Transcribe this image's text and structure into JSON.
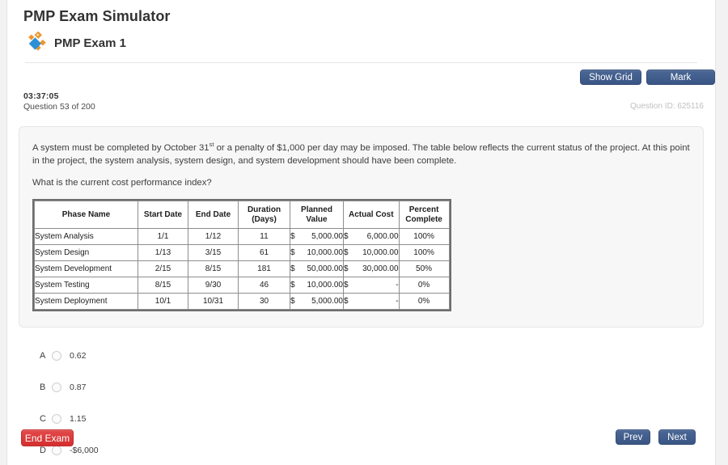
{
  "header": {
    "app_title": "PMP Exam Simulator",
    "exam_title": "PMP Exam 1",
    "logo_icon": "diamond-logo-icon"
  },
  "toolbar": {
    "show_grid_label": "Show Grid",
    "mark_label": "Mark"
  },
  "status": {
    "timer": "03:37:05",
    "question_counter": "Question 53 of 200",
    "question_id": "Question ID: 625116"
  },
  "question": {
    "stem_before_sup": "A system must be completed by October 31",
    "stem_sup": "st",
    "stem_after_sup": " or a penalty of $1,000 per day may be imposed. The table below reflects the current status of the project. At this point in the project, the system analysis, system design, and system development should have been complete.",
    "prompt": "What is the current cost performance index?"
  },
  "table": {
    "columns": [
      "Phase Name",
      "Start Date",
      "End Date",
      "Duration (Days)",
      "Planned Value",
      "Actual Cost",
      "Percent Complete"
    ],
    "column_lines": [
      [
        "Phase Name"
      ],
      [
        "Start Date"
      ],
      [
        "End Date"
      ],
      [
        "Duration",
        "(Days)"
      ],
      [
        "Planned",
        "Value"
      ],
      [
        "Actual Cost"
      ],
      [
        "Percent",
        "Complete"
      ]
    ],
    "rows": [
      {
        "phase": "System Analysis",
        "start_date": "1/1",
        "end_date": "1/12",
        "duration": "11",
        "planned_symbol": "$",
        "planned_value": "5,000.00",
        "actual_symbol": "$",
        "actual_cost": "6,000.00",
        "percent_complete": "100%"
      },
      {
        "phase": "System Design",
        "start_date": "1/13",
        "end_date": "3/15",
        "duration": "61",
        "planned_symbol": "$",
        "planned_value": "10,000.00",
        "actual_symbol": "$",
        "actual_cost": "10,000.00",
        "percent_complete": "100%"
      },
      {
        "phase": "System Development",
        "start_date": "2/15",
        "end_date": "8/15",
        "duration": "181",
        "planned_symbol": "$",
        "planned_value": "50,000.00",
        "actual_symbol": "$",
        "actual_cost": "30,000.00",
        "percent_complete": "50%"
      },
      {
        "phase": "System Testing",
        "start_date": "8/15",
        "end_date": "9/30",
        "duration": "46",
        "planned_symbol": "$",
        "planned_value": "10,000.00",
        "actual_symbol": "$",
        "actual_cost": "-",
        "percent_complete": "0%"
      },
      {
        "phase": "System Deployment",
        "start_date": "10/1",
        "end_date": "10/31",
        "duration": "30",
        "planned_symbol": "$",
        "planned_value": "5,000.00",
        "actual_symbol": "$",
        "actual_cost": "-",
        "percent_complete": "0%"
      }
    ]
  },
  "answers": [
    {
      "letter": "A",
      "text": "0.62",
      "selected": false
    },
    {
      "letter": "B",
      "text": "0.87",
      "selected": false
    },
    {
      "letter": "C",
      "text": "1.15",
      "selected": false
    },
    {
      "letter": "D",
      "text": "-$6,000",
      "selected": false
    }
  ],
  "footer": {
    "end_exam_label": "End Exam",
    "prev_label": "Prev",
    "next_label": "Next"
  },
  "colors": {
    "button_blue": "#3f5c8c",
    "button_red": "#dd3b3b",
    "panel_background": "#f7f7f7",
    "page_background": "#f2f2f2",
    "logo_orange": "#f0952b",
    "logo_blue": "#2d8fd5",
    "muted_text": "#bfbfbf"
  }
}
